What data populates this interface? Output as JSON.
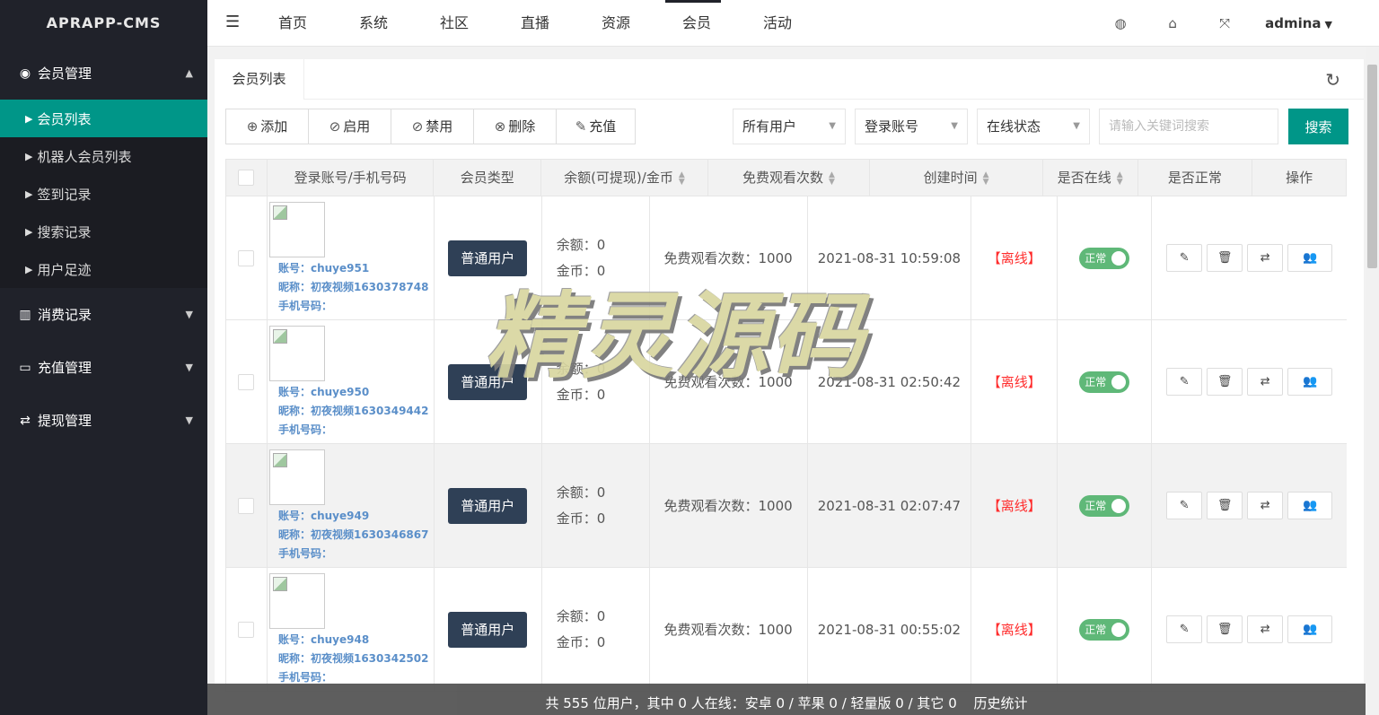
{
  "app": {
    "brand": "APRAPP-CMS"
  },
  "sidebar": {
    "groups": [
      {
        "label": "会员管理",
        "icon": "user-circle-icon",
        "expanded": true
      },
      {
        "label": "消费记录",
        "icon": "bar-chart-icon",
        "expanded": false
      },
      {
        "label": "充值管理",
        "icon": "credit-card-icon",
        "expanded": false
      },
      {
        "label": "提现管理",
        "icon": "exchange-icon",
        "expanded": false
      }
    ],
    "items": [
      "会员列表",
      "机器人会员列表",
      "签到记录",
      "搜索记录",
      "用户足迹"
    ],
    "active_item": "会员列表"
  },
  "header": {
    "nav": [
      "首页",
      "系统",
      "社区",
      "直播",
      "资源",
      "会员",
      "活动"
    ],
    "active_nav": "会员",
    "icons": [
      "palette-icon",
      "tag-icon",
      "fullscreen-icon"
    ],
    "user": "admina"
  },
  "page": {
    "tab": "会员列表",
    "toolbar": {
      "add": "添加",
      "enable": "启用",
      "disable": "禁用",
      "delete": "删除",
      "recharge": "充值"
    },
    "filters": {
      "user_type": "所有用户",
      "account_field": "登录账号",
      "online_status": "在线状态",
      "search_placeholder": "请输入关键词搜索",
      "search_button": "搜索"
    }
  },
  "table": {
    "columns": [
      "登录账号/手机号码",
      "会员类型",
      "余额(可提现)/金币",
      "免费观看次数",
      "创建时间",
      "是否在线",
      "是否正常",
      "操作"
    ],
    "labels": {
      "account": "账号：",
      "nickname": "昵称：",
      "phone": "手机号码：",
      "balance": "余额：",
      "coins": "金币：",
      "free_views": "免费观看次数："
    },
    "rows": [
      {
        "account": "chuye951",
        "nickname": "初夜视频1630378748",
        "phone": "",
        "type": "普通用户",
        "balance": "0",
        "coins": "0",
        "free_views": "1000",
        "created": "2021-08-31 10:59:08",
        "online": "【离线】",
        "status": "正常"
      },
      {
        "account": "chuye950",
        "nickname": "初夜视频1630349442",
        "phone": "",
        "type": "普通用户",
        "balance": "0",
        "coins": "0",
        "free_views": "1000",
        "created": "2021-08-31 02:50:42",
        "online": "【离线】",
        "status": "正常"
      },
      {
        "account": "chuye949",
        "nickname": "初夜视频1630346867",
        "phone": "",
        "type": "普通用户",
        "balance": "0",
        "coins": "0",
        "free_views": "1000",
        "created": "2021-08-31 02:07:47",
        "online": "【离线】",
        "status": "正常"
      },
      {
        "account": "chuye948",
        "nickname": "初夜视频1630342502",
        "phone": "",
        "type": "普通用户",
        "balance": "0",
        "coins": "0",
        "free_views": "1000",
        "created": "2021-08-31 00:55:02",
        "online": "【离线】",
        "status": "正常"
      }
    ]
  },
  "footer": {
    "summary": "共 555 位用户，其中 0 人在线：安卓 0 / 苹果 0 / 轻量版 0 / 其它 0",
    "history": "历史统计"
  },
  "watermark": "精灵源码",
  "colors": {
    "accent": "#009688",
    "sidebar": "#20222a",
    "badge": "#2f4056",
    "switch_on": "#5fb878",
    "offline": "#ff2d2d"
  }
}
